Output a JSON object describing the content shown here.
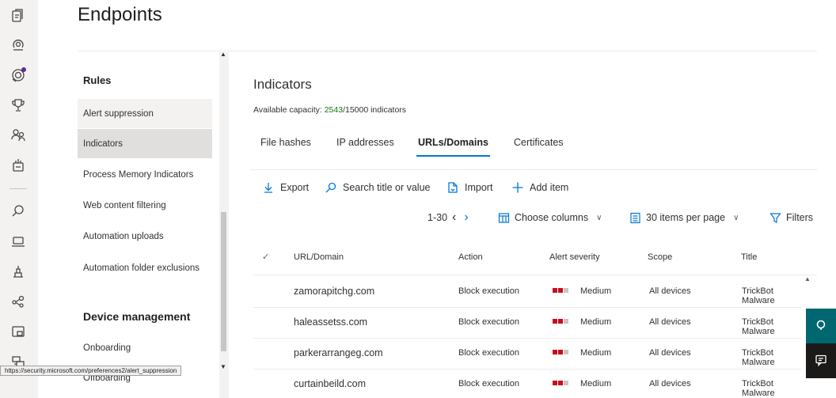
{
  "page": {
    "title": "Endpoints"
  },
  "rail": {
    "icons": [
      "incidents-icon",
      "hunting-icon",
      "action-center-icon",
      "score-icon",
      "partners-icon",
      "evaluation-icon",
      "search-icon",
      "device-inventory-icon",
      "vulnerability-icon",
      "configuration-icon",
      "email-icon",
      "reports-icon"
    ]
  },
  "nav": {
    "rules_heading": "Rules",
    "items": [
      {
        "label": "Alert suppression"
      },
      {
        "label": "Indicators"
      },
      {
        "label": "Process Memory Indicators"
      },
      {
        "label": "Web content filtering"
      },
      {
        "label": "Automation uploads"
      },
      {
        "label": "Automation folder exclusions"
      }
    ],
    "device_heading": "Device management",
    "device_items": [
      {
        "label": "Onboarding"
      },
      {
        "label": "Offboarding"
      }
    ]
  },
  "main": {
    "heading": "Indicators",
    "capacity_label": "Available capacity:",
    "capacity_used": "2543",
    "capacity_total": "/15000 indicators",
    "tabs": [
      {
        "label": "File hashes"
      },
      {
        "label": "IP addresses"
      },
      {
        "label": "URLs/Domains"
      },
      {
        "label": "Certificates"
      }
    ],
    "commands": {
      "export": "Export",
      "search": "Search title or value",
      "import": "Import",
      "add": "Add item"
    },
    "paging": {
      "range": "1-30",
      "choose_columns": "Choose columns",
      "per_page": "30 items per page",
      "filters": "Filters"
    },
    "table": {
      "columns": [
        "URL/Domain",
        "Action",
        "Alert severity",
        "Scope",
        "Title"
      ],
      "rows": [
        {
          "url": "zamorapitchg.com",
          "action": "Block execution",
          "severity": "Medium",
          "scope": "All devices",
          "title": "TrickBot Malware"
        },
        {
          "url": "haleassetss.com",
          "action": "Block execution",
          "severity": "Medium",
          "scope": "All devices",
          "title": "TrickBot Malware"
        },
        {
          "url": "parkerarrangeg.com",
          "action": "Block execution",
          "severity": "Medium",
          "scope": "All devices",
          "title": "TrickBot Malware"
        },
        {
          "url": "curtainbeild.com",
          "action": "Block execution",
          "severity": "Medium",
          "scope": "All devices",
          "title": "TrickBot Malware"
        }
      ]
    }
  },
  "statusbar": {
    "url": "https://security.microsoft.com/preferences2/alert_suppression"
  },
  "colors": {
    "accent": "#0078d4",
    "capacity_green": "#107c10",
    "severity_red": "#c50f1f",
    "severity_empty": "#c8c6c4",
    "float_teal": "#006770",
    "float_dark": "#1b1a19"
  }
}
